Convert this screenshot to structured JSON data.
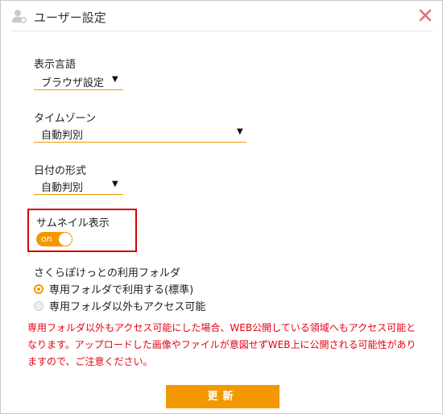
{
  "dialog": {
    "title": "ユーザー設定",
    "user_icon": "user-settings-icon",
    "close_icon": "close-icon",
    "colors": {
      "accent": "#f39800",
      "close": "#e96b73",
      "warning": "#e60012",
      "highlight_border": "#d40000"
    }
  },
  "display_language": {
    "label": "表示言語",
    "value": "ブラウザ設定"
  },
  "timezone": {
    "label": "タイムゾーン",
    "value": "自動判別"
  },
  "date_format": {
    "label": "日付の形式",
    "value": "自動判別"
  },
  "thumbnail": {
    "label": "サムネイル表示",
    "toggle_text": "on",
    "enabled": true
  },
  "folder": {
    "label": "さくらぽけっとの利用フォルダ",
    "options": [
      {
        "label": "専用フォルダで利用する(標準)",
        "checked": true
      },
      {
        "label": "専用フォルダ以外もアクセス可能",
        "checked": false
      }
    ]
  },
  "warning_text": "専用フォルダ以外もアクセス可能にした場合、WEB公開している領域へもアクセス可能となります。アップロードした画像やファイルが意図せずWEB上に公開される可能性がありますので、ご注意ください。",
  "update_button": "更新"
}
